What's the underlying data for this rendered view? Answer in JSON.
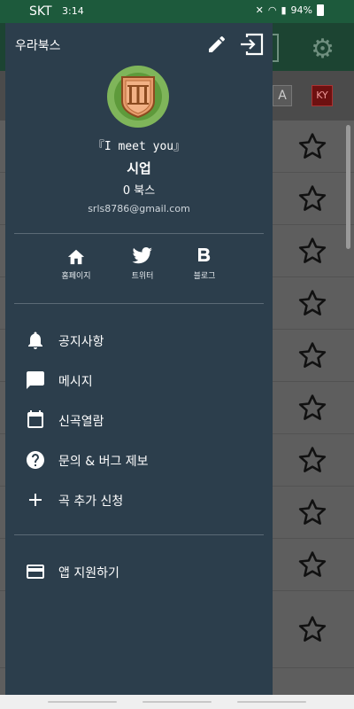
{
  "status": {
    "carrier": "SKT",
    "time": "3:14",
    "battery": "94%"
  },
  "drawer": {
    "title": "우라북스",
    "motto": "『I meet you』",
    "user_name": "시업",
    "books": "0 북스",
    "email": "srls8786@gmail.com",
    "links": [
      {
        "label": "홈페이지",
        "icon": "home-icon"
      },
      {
        "label": "트위터",
        "icon": "twitter-icon"
      },
      {
        "label": "블로그",
        "icon": "blog-icon"
      }
    ],
    "menu": [
      {
        "label": "공지사항",
        "icon": "bell-icon"
      },
      {
        "label": "메시지",
        "icon": "message-icon"
      },
      {
        "label": "신곡열람",
        "icon": "calendar-icon"
      },
      {
        "label": "문의 & 버그 제보",
        "icon": "help-icon"
      },
      {
        "label": "곡 추가 신청",
        "icon": "plus-icon"
      }
    ],
    "support": {
      "label": "앱 지원하기",
      "icon": "card-icon"
    }
  },
  "background": {
    "tag_a": "A",
    "tag_ky": "KY",
    "row_count": 10
  },
  "colors": {
    "drawer_bg": "#2c3e4c",
    "statusbar": "#1d5a3c",
    "avatar_green": "#7fb55a",
    "badge_orange": "#e59b6b"
  }
}
